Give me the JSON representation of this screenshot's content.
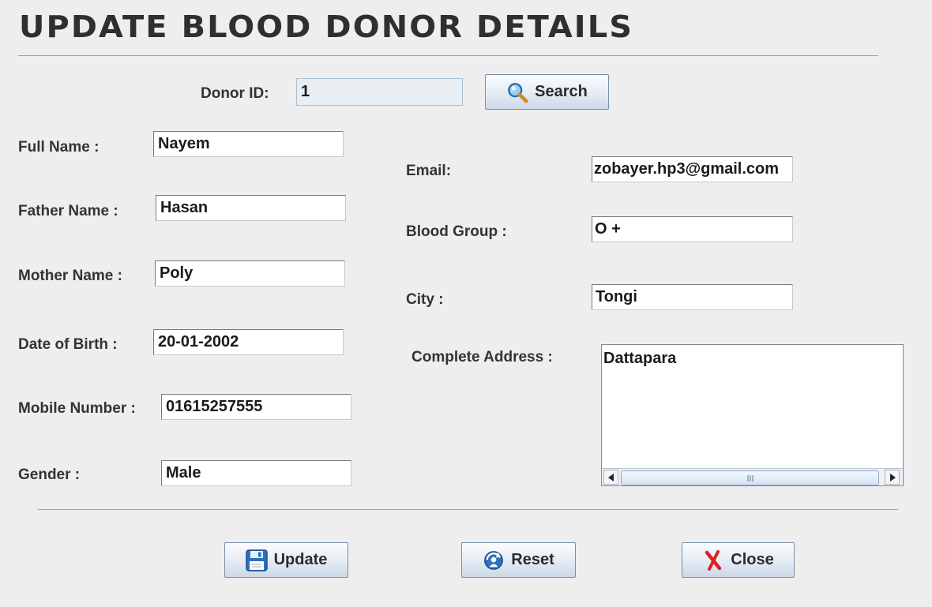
{
  "header": {
    "title": "UPDATE BLOOD DONOR DETAILS"
  },
  "search": {
    "donor_id_label": "Donor ID:",
    "donor_id_value": "1",
    "search_button": "Search"
  },
  "left_fields": {
    "full_name": {
      "label": "Full Name :",
      "value": "Nayem"
    },
    "father_name": {
      "label": "Father Name :",
      "value": "Hasan"
    },
    "mother_name": {
      "label": "Mother Name :",
      "value": "Poly"
    },
    "date_of_birth": {
      "label": "Date of Birth :",
      "value": "20-01-2002"
    },
    "mobile_number": {
      "label": "Mobile Number :",
      "value": "01615257555"
    },
    "gender": {
      "label": "Gender :",
      "value": "Male"
    }
  },
  "right_fields": {
    "email": {
      "label": "Email:",
      "value": "zobayer.hp3@gmail.com"
    },
    "blood_group": {
      "label": "Blood Group :",
      "value": "O +"
    },
    "city": {
      "label": "City :",
      "value": "Tongi"
    },
    "complete_address": {
      "label": "Complete Address :",
      "value": "Dattapara"
    }
  },
  "actions": {
    "update": "Update",
    "reset": "Reset",
    "close": "Close"
  },
  "icons": {
    "search": "magnifier-icon",
    "update": "floppy-disk-icon",
    "reset": "refresh-user-icon",
    "close": "red-x-icon"
  },
  "colors": {
    "background": "#eeeeee",
    "separator": "#8ea3c8",
    "close_icon": "#e02020",
    "save_icon": "#2a6fc0"
  }
}
